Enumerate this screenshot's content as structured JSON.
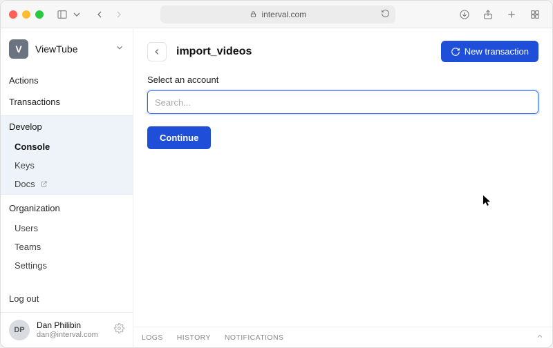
{
  "browser": {
    "address": "interval.com"
  },
  "workspace": {
    "badge": "V",
    "name": "ViewTube"
  },
  "sidebar": {
    "actions": "Actions",
    "transactions": "Transactions",
    "develop": {
      "label": "Develop",
      "items": {
        "console": "Console",
        "keys": "Keys",
        "docs": "Docs"
      }
    },
    "organization": {
      "label": "Organization",
      "items": {
        "users": "Users",
        "teams": "Teams",
        "settings": "Settings"
      }
    },
    "logout": "Log out"
  },
  "profile": {
    "initials": "DP",
    "name": "Dan Philibin",
    "email": "dan@interval.com"
  },
  "header": {
    "title": "import_videos",
    "new_transaction": "New transaction"
  },
  "form": {
    "label": "Select an account",
    "search_placeholder": "Search...",
    "continue": "Continue"
  },
  "bottom_tabs": {
    "logs": "LOGS",
    "history": "HISTORY",
    "notifications": "NOTIFICATIONS"
  }
}
